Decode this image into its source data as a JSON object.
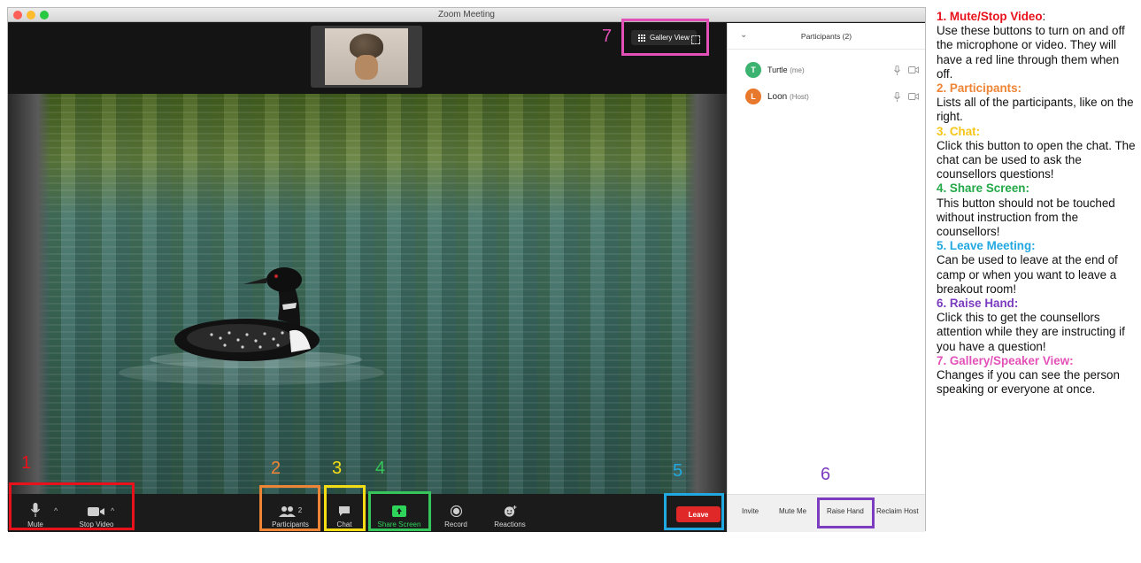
{
  "window": {
    "title": "Zoom Meeting"
  },
  "stage": {
    "gallery_view_label": "Gallery View"
  },
  "toolbar": {
    "mute_label": "Mute",
    "stop_video_label": "Stop Video",
    "participants_label": "Participants",
    "participants_count": "2",
    "chat_label": "Chat",
    "share_screen_label": "Share Screen",
    "record_label": "Record",
    "reactions_label": "Reactions",
    "leave_label": "Leave"
  },
  "panel": {
    "title": "Participants (2)",
    "participants": [
      {
        "initial": "T",
        "name": "Turtle",
        "role": "(me)",
        "color": "#3cb371"
      },
      {
        "initial": "L",
        "name": "Loon",
        "role": "(Host)",
        "color": "#e8782c"
      }
    ],
    "footer": {
      "invite_label": "Invite",
      "mute_me_label": "Mute Me",
      "raise_hand_label": "Raise Hand",
      "reclaim_host_label": "Reclaim Host"
    }
  },
  "callouts": [
    "1",
    "2",
    "3",
    "4",
    "5",
    "6",
    "7"
  ],
  "colors": {
    "red": "#e8111c",
    "orange": "#ee8436",
    "yellow": "#f5dd16",
    "green": "#35c55a",
    "blue": "#22a8e0",
    "purple": "#7b3cbf",
    "pink": "#e351b8"
  },
  "legend": [
    {
      "heading": "1. Mute/Stop Video",
      "suffix": ":",
      "color": "#e8111c",
      "text": "Use these buttons to turn on and off the microphone or video. They will have a red line through them when off."
    },
    {
      "heading": "2. Participants:",
      "suffix": "",
      "color": "#ee8436",
      "text": "Lists all of the participants, like on the right."
    },
    {
      "heading": "3. Chat:",
      "suffix": "",
      "color": "#f5c517",
      "text": "Click this button to open the chat. The chat can be used to ask the counsellors questions!"
    },
    {
      "heading": "4. Share Screen:",
      "suffix": "",
      "color": "#22a846",
      "text": "This button should not be touched without instruction from the counsellors!"
    },
    {
      "heading": "5. Leave Meeting:",
      "suffix": "",
      "color": "#22a8e0",
      "text": "Can be used to leave at the end of camp or when you want to leave a breakout room!"
    },
    {
      "heading": "6. Raise Hand:",
      "suffix": "",
      "color": "#7b3cbf",
      "text": "Click this to get the counsellors attention while they are instructing if you have a question!"
    },
    {
      "heading": "7. Gallery/Speaker View:",
      "suffix": "",
      "color": "#e351b8",
      "text": "Changes if you can see the person speaking or everyone at once."
    }
  ]
}
